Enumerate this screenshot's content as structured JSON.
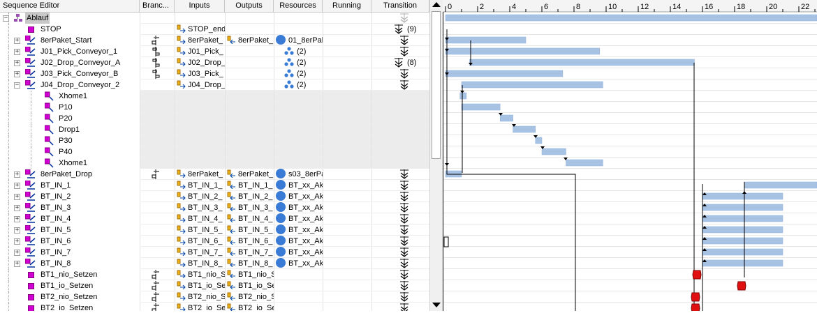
{
  "columns": [
    "Sequence Editor",
    "Branc...",
    "Inputs",
    "Outputs",
    "Resources",
    "Running",
    "Transition"
  ],
  "rows": [
    {
      "name": "Ablauf",
      "type": "root",
      "exp": "-",
      "input": "",
      "output": "",
      "res": "",
      "trans": "arrow-gray"
    },
    {
      "name": "STOP",
      "type": "sq",
      "exp": "",
      "branch": "",
      "input": "STOP_end",
      "output": "",
      "res": "",
      "trans": "(9)"
    },
    {
      "name": "8erPaket_Start",
      "type": "seq",
      "exp": "+",
      "branch": "b",
      "input": "8erPaket_",
      "output": "8erPaket_",
      "res": "01_8erPak",
      "resicon": "dot",
      "trans": "arrows"
    },
    {
      "name": "J01_Pick_Conveyor_1",
      "type": "seq",
      "exp": "+",
      "branch": "b2",
      "input": "J01_Pick_",
      "output": "",
      "res": "(2)",
      "resicon": "tri",
      "trans": "arrows"
    },
    {
      "name": "J02_Drop_Conveyor_A",
      "type": "seq",
      "exp": "+",
      "branch": "b2",
      "input": "J02_Drop_",
      "output": "",
      "res": "(2)",
      "resicon": "tri",
      "trans": "(8)"
    },
    {
      "name": "J03_Pick_Conveyor_B",
      "type": "seq",
      "exp": "+",
      "branch": "b2",
      "input": "J03_Pick_",
      "output": "",
      "res": "(2)",
      "resicon": "tri",
      "trans": "arrows"
    },
    {
      "name": "J04_Drop_Conveyor_2",
      "type": "seq",
      "exp": "-",
      "branch": "",
      "input": "J04_Drop_",
      "output": "",
      "res": "(2)",
      "resicon": "tri",
      "trans": "arrows"
    },
    {
      "name": "Xhome1",
      "type": "sub",
      "grey": true
    },
    {
      "name": "P10",
      "type": "sub",
      "grey": true
    },
    {
      "name": "P20",
      "type": "sub",
      "grey": true
    },
    {
      "name": "Drop1",
      "type": "sub",
      "grey": true
    },
    {
      "name": "P30",
      "type": "sub",
      "grey": true
    },
    {
      "name": "P40",
      "type": "sub",
      "grey": true
    },
    {
      "name": "Xhome1",
      "type": "sub",
      "grey": true
    },
    {
      "name": "8erPaket_Drop",
      "type": "seq",
      "exp": "+",
      "branch": "b",
      "input": "8erPaket_",
      "output": "8erPaket_",
      "res": "s03_8erPa",
      "resicon": "dot",
      "trans": "arrows"
    },
    {
      "name": "BT_IN_1",
      "type": "seq",
      "exp": "+",
      "input": "BT_IN_1_",
      "output": "BT_IN_1_",
      "res": "BT_xx_Ak",
      "resicon": "dot",
      "trans": "arrows"
    },
    {
      "name": "BT_IN_2",
      "type": "seq",
      "exp": "+",
      "input": "BT_IN_2_",
      "output": "BT_IN_2_",
      "res": "BT_xx_Ak",
      "resicon": "dot",
      "trans": "arrows"
    },
    {
      "name": "BT_IN_3",
      "type": "seq",
      "exp": "+",
      "input": "BT_IN_3_",
      "output": "BT_IN_3_",
      "res": "BT_xx_Ak",
      "resicon": "dot",
      "trans": "arrows"
    },
    {
      "name": "BT_IN_4",
      "type": "seq",
      "exp": "+",
      "input": "BT_IN_4_",
      "output": "BT_IN_4_",
      "res": "BT_xx_Ak",
      "resicon": "dot",
      "trans": "arrows"
    },
    {
      "name": "BT_IN_5",
      "type": "seq",
      "exp": "+",
      "input": "BT_IN_5_",
      "output": "BT_IN_5_",
      "res": "BT_xx_Ak",
      "resicon": "dot",
      "trans": "arrows"
    },
    {
      "name": "BT_IN_6",
      "type": "seq",
      "exp": "+",
      "input": "BT_IN_6_",
      "output": "BT_IN_6_",
      "res": "BT_xx_Ak",
      "resicon": "dot",
      "trans": "arrows"
    },
    {
      "name": "BT_IN_7",
      "type": "seq",
      "exp": "+",
      "input": "BT_IN_7_",
      "output": "BT_IN_7_",
      "res": "BT_xx_Ak",
      "resicon": "dot",
      "trans": "arrows"
    },
    {
      "name": "BT_IN_8",
      "type": "seq",
      "exp": "+",
      "input": "BT_IN_8_",
      "output": "BT_IN_8_",
      "res": "BT_xx_Ak",
      "resicon": "dot",
      "trans": "arrows"
    },
    {
      "name": "BT1_nio_Setzen",
      "type": "sq",
      "exp": "",
      "branch": "b",
      "input": "BT1_nio_S",
      "output": "BT1_nio_S",
      "res": "",
      "trans": "arrows"
    },
    {
      "name": "BT1_io_Setzen",
      "type": "sq",
      "exp": "",
      "branch": "b",
      "input": "BT1_io_Se",
      "output": "BT1_io_Se",
      "res": "",
      "trans": "arrows"
    },
    {
      "name": "BT2_nio_Setzen",
      "type": "sq",
      "exp": "",
      "branch": "b",
      "input": "BT2_nio_S",
      "output": "BT2_nio_S",
      "res": "",
      "trans": "arrows"
    },
    {
      "name": "BT2_io_Setzen",
      "type": "sq",
      "exp": "",
      "branch": "b",
      "input": "BT2_io_Se",
      "output": "BT2_io_Se",
      "res": "",
      "trans": "arrows"
    }
  ],
  "gantt": {
    "ticks": [
      "0",
      "2",
      "4",
      "6",
      "8",
      "10",
      "12",
      "14",
      "16",
      "18",
      "20",
      "22"
    ],
    "bars": [
      {
        "row": 0,
        "start": 0,
        "end": 24
      },
      {
        "row": 2,
        "start": 0,
        "end": 5
      },
      {
        "row": 3,
        "start": 0,
        "end": 9.6
      },
      {
        "row": 4,
        "start": 1.5,
        "end": 15.5
      },
      {
        "row": 5,
        "start": 0,
        "end": 7.3
      },
      {
        "row": 6,
        "start": 1,
        "end": 9.8
      },
      {
        "row": 7,
        "start": 0.9,
        "end": 1.3
      },
      {
        "row": 8,
        "start": 1.0,
        "end": 3.4
      },
      {
        "row": 9,
        "start": 3.4,
        "end": 4.2
      },
      {
        "row": 10,
        "start": 4.2,
        "end": 5.6
      },
      {
        "row": 11,
        "start": 5.6,
        "end": 6.0
      },
      {
        "row": 12,
        "start": 6.0,
        "end": 7.5
      },
      {
        "row": 13,
        "start": 7.5,
        "end": 9.8
      },
      {
        "row": 14,
        "start": 0,
        "end": 1.0
      },
      {
        "row": 15,
        "start": 18.6,
        "end": 24
      },
      {
        "row": 16,
        "start": 16,
        "end": 21
      },
      {
        "row": 17,
        "start": 16,
        "end": 21
      },
      {
        "row": 18,
        "start": 16,
        "end": 21
      },
      {
        "row": 19,
        "start": 16,
        "end": 21
      },
      {
        "row": 20,
        "start": 16,
        "end": 21
      },
      {
        "row": 21,
        "start": 16,
        "end": 21
      },
      {
        "row": 22,
        "start": 16,
        "end": 21
      }
    ]
  }
}
